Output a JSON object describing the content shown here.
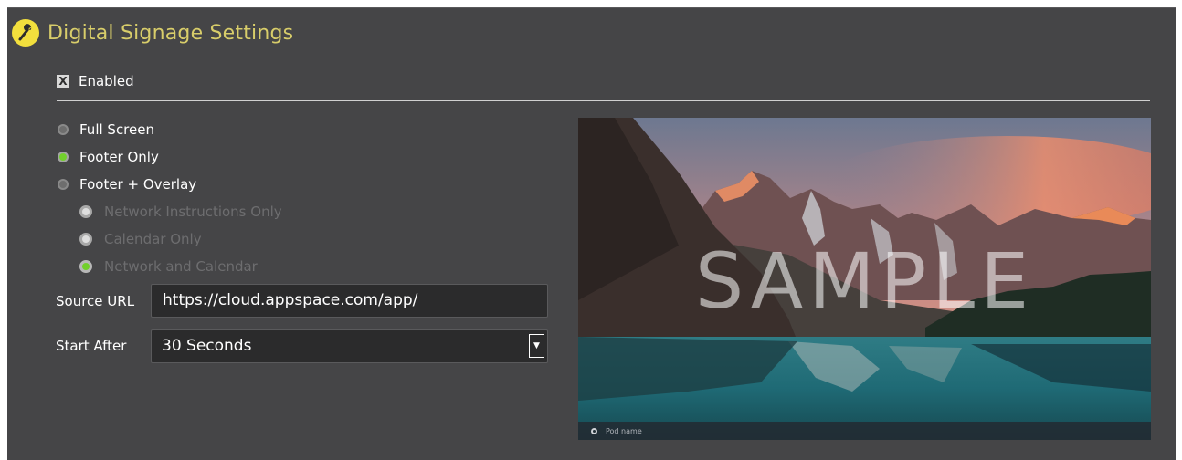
{
  "header": {
    "title": "Digital Signage Settings",
    "icon": "wrench-icon"
  },
  "enabled": {
    "label": "Enabled",
    "checked": true,
    "mark": "X"
  },
  "display_modes": [
    {
      "label": "Full Screen",
      "selected": false,
      "disabled": false
    },
    {
      "label": "Footer Only",
      "selected": true,
      "disabled": false
    },
    {
      "label": "Footer + Overlay",
      "selected": false,
      "disabled": false
    }
  ],
  "overlay_options": [
    {
      "label": "Network Instructions Only",
      "selected": false,
      "disabled": true
    },
    {
      "label": "Calendar Only",
      "selected": false,
      "disabled": true
    },
    {
      "label": "Network and Calendar",
      "selected": true,
      "disabled": true
    }
  ],
  "source_url": {
    "label": "Source URL",
    "value": "https://cloud.appspace.com/app/"
  },
  "start_after": {
    "label": "Start After",
    "value": "30 Seconds"
  },
  "preview": {
    "watermark": "SAMPLE",
    "pod_name": "Pod name"
  },
  "colors": {
    "panel": "#454547",
    "title": "#d8cd6a",
    "accent": "#72d02c",
    "icon_bg": "#f2df3d"
  }
}
